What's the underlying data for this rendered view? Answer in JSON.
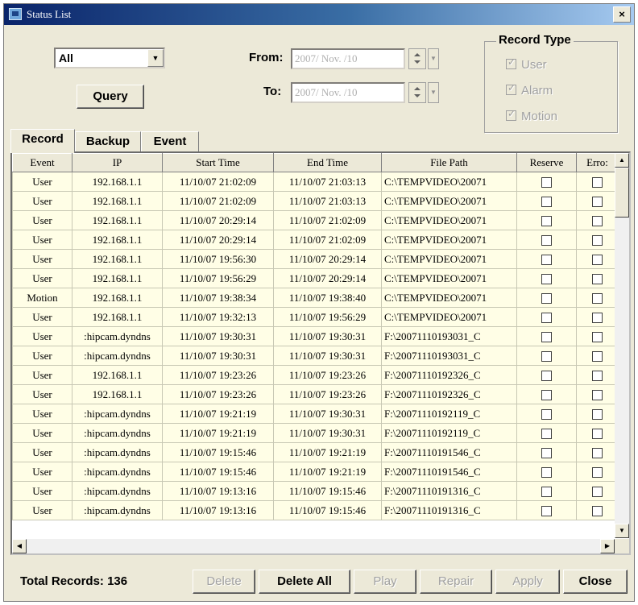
{
  "window": {
    "title": "Status List",
    "close_glyph": "×"
  },
  "filter": {
    "selected": "All",
    "query_label": "Query"
  },
  "date": {
    "from_label": "From:",
    "from_value": "2007/ Nov. /10",
    "to_label": "To:",
    "to_value": "2007/ Nov. /10"
  },
  "record_type": {
    "title": "Record Type",
    "options": [
      {
        "label": "User",
        "checked": true
      },
      {
        "label": "Alarm",
        "checked": true
      },
      {
        "label": "Motion",
        "checked": true
      }
    ]
  },
  "tabs": [
    {
      "label": "Record",
      "active": true
    },
    {
      "label": "Backup",
      "active": false
    },
    {
      "label": "Event",
      "active": false
    }
  ],
  "table": {
    "columns": [
      "Event",
      "IP",
      "Start Time",
      "End Time",
      "File Path",
      "Reserve",
      "Erro:"
    ],
    "rows": [
      [
        "User",
        "192.168.1.1",
        "11/10/07 21:02:09",
        "11/10/07 21:03:13",
        "C:\\TEMPVIDEO\\20071"
      ],
      [
        "User",
        "192.168.1.1",
        "11/10/07 21:02:09",
        "11/10/07 21:03:13",
        "C:\\TEMPVIDEO\\20071"
      ],
      [
        "User",
        "192.168.1.1",
        "11/10/07 20:29:14",
        "11/10/07 21:02:09",
        "C:\\TEMPVIDEO\\20071"
      ],
      [
        "User",
        "192.168.1.1",
        "11/10/07 20:29:14",
        "11/10/07 21:02:09",
        "C:\\TEMPVIDEO\\20071"
      ],
      [
        "User",
        "192.168.1.1",
        "11/10/07 19:56:30",
        "11/10/07 20:29:14",
        "C:\\TEMPVIDEO\\20071"
      ],
      [
        "User",
        "192.168.1.1",
        "11/10/07 19:56:29",
        "11/10/07 20:29:14",
        "C:\\TEMPVIDEO\\20071"
      ],
      [
        "Motion",
        "192.168.1.1",
        "11/10/07 19:38:34",
        "11/10/07 19:38:40",
        "C:\\TEMPVIDEO\\20071"
      ],
      [
        "User",
        "192.168.1.1",
        "11/10/07 19:32:13",
        "11/10/07 19:56:29",
        "C:\\TEMPVIDEO\\20071"
      ],
      [
        "User",
        ":hipcam.dyndns",
        "11/10/07 19:30:31",
        "11/10/07 19:30:31",
        "F:\\20071110193031_C"
      ],
      [
        "User",
        ":hipcam.dyndns",
        "11/10/07 19:30:31",
        "11/10/07 19:30:31",
        "F:\\20071110193031_C"
      ],
      [
        "User",
        "192.168.1.1",
        "11/10/07 19:23:26",
        "11/10/07 19:23:26",
        "F:\\20071110192326_C"
      ],
      [
        "User",
        "192.168.1.1",
        "11/10/07 19:23:26",
        "11/10/07 19:23:26",
        "F:\\20071110192326_C"
      ],
      [
        "User",
        ":hipcam.dyndns",
        "11/10/07 19:21:19",
        "11/10/07 19:30:31",
        "F:\\20071110192119_C"
      ],
      [
        "User",
        ":hipcam.dyndns",
        "11/10/07 19:21:19",
        "11/10/07 19:30:31",
        "F:\\20071110192119_C"
      ],
      [
        "User",
        ":hipcam.dyndns",
        "11/10/07 19:15:46",
        "11/10/07 19:21:19",
        "F:\\20071110191546_C"
      ],
      [
        "User",
        ":hipcam.dyndns",
        "11/10/07 19:15:46",
        "11/10/07 19:21:19",
        "F:\\20071110191546_C"
      ],
      [
        "User",
        ":hipcam.dyndns",
        "11/10/07 19:13:16",
        "11/10/07 19:15:46",
        "F:\\20071110191316_C"
      ],
      [
        "User",
        ":hipcam.dyndns",
        "11/10/07 19:13:16",
        "11/10/07 19:15:46",
        "F:\\20071110191316_C"
      ]
    ]
  },
  "footer": {
    "total_label": "Total Records:",
    "total_value": "136",
    "buttons": {
      "delete": "Delete",
      "delete_all": "Delete All",
      "play": "Play",
      "repair": "Repair",
      "apply": "Apply",
      "close": "Close"
    }
  }
}
